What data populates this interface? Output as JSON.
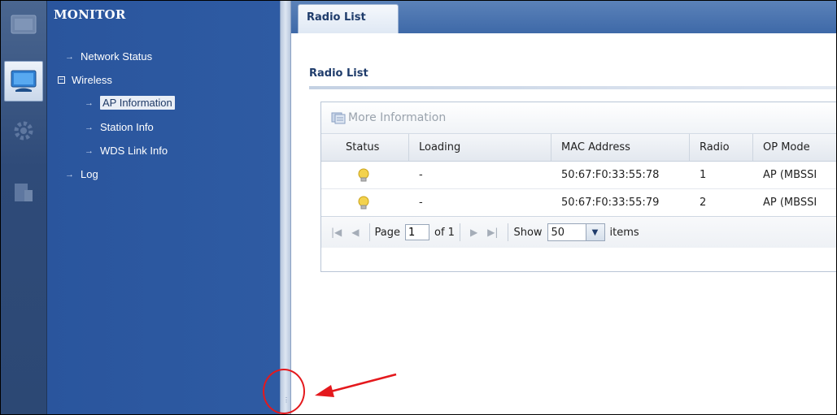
{
  "nav": {
    "title": "MONITOR",
    "items": [
      {
        "label": "Network Status",
        "bullet": "→"
      },
      {
        "label": "Wireless",
        "expander": "−"
      },
      {
        "label": "AP Information",
        "bullet": "→",
        "selected": true
      },
      {
        "label": "Station Info",
        "bullet": "→"
      },
      {
        "label": "WDS Link Info",
        "bullet": "→"
      },
      {
        "label": "Log",
        "bullet": "→"
      }
    ]
  },
  "tabs": [
    {
      "label": "Radio List"
    }
  ],
  "section": {
    "title": "Radio List"
  },
  "toolbar": {
    "more_info_label": "More Information"
  },
  "table": {
    "columns": [
      "Status",
      "Loading",
      "MAC Address",
      "Radio",
      "OP Mode"
    ],
    "rows": [
      {
        "status_icon": "bulb-icon",
        "loading": "-",
        "mac": "50:67:F0:33:55:78",
        "radio": "1",
        "op_mode": "AP (MBSSI"
      },
      {
        "status_icon": "bulb-icon",
        "loading": "-",
        "mac": "50:67:F0:33:55:79",
        "radio": "2",
        "op_mode": "AP (MBSSI"
      }
    ]
  },
  "pager": {
    "page_label": "Page",
    "page_value": "1",
    "of_label": "of 1",
    "show_label": "Show",
    "show_value": "50",
    "items_label": "items"
  },
  "colors": {
    "nav_bg": "#2d58a0",
    "tabbar": "#4a74b0",
    "annotation": "#e4191d"
  }
}
